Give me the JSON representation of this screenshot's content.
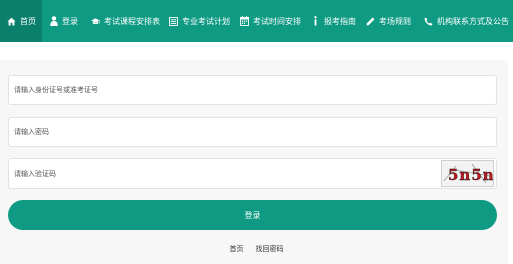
{
  "nav": {
    "items": [
      {
        "label": "首页",
        "icon": "home-icon"
      },
      {
        "label": "登录",
        "icon": "user-icon"
      },
      {
        "label": "考试课程安排表",
        "icon": "graduation-cap-icon"
      },
      {
        "label": "专业考试计划",
        "icon": "list-icon"
      },
      {
        "label": "考试时间安排",
        "icon": "calendar-icon"
      },
      {
        "label": "报考指南",
        "icon": "info-icon"
      },
      {
        "label": "考场规则",
        "icon": "pencil-icon"
      },
      {
        "label": "机构联系方式及公告",
        "icon": "phone-icon"
      }
    ]
  },
  "form": {
    "id_placeholder": "请输入身份证号或准考证号",
    "password_placeholder": "请输入密码",
    "captcha_placeholder": "请输入验证码",
    "captcha_text": "5n5n",
    "login_label": "登录"
  },
  "footer": {
    "home_label": "首页",
    "recover_label": "找回密码"
  },
  "colors": {
    "primary": "#0f9b83",
    "nav_active": "#0a7f6b",
    "panel_bg": "#f7f7f7",
    "captcha_text": "#c0171c"
  }
}
